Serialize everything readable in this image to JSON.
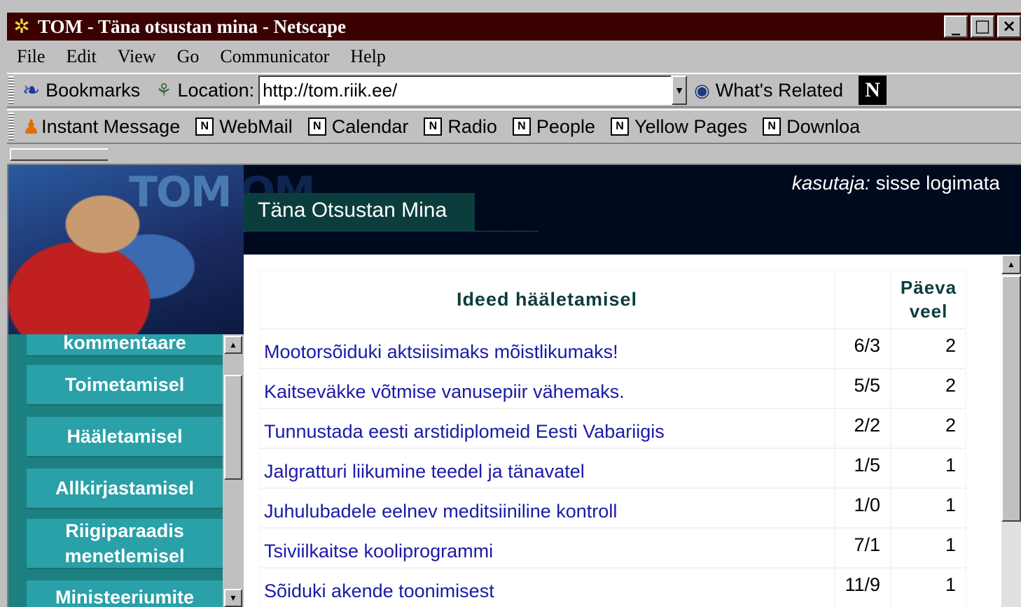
{
  "window": {
    "title": "TOM - Täna otsustan mina - Netscape"
  },
  "menu": [
    "File",
    "Edit",
    "View",
    "Go",
    "Communicator",
    "Help"
  ],
  "nav_toolbar": {
    "bookmarks": "Bookmarks",
    "location_label": "Location:",
    "location_value": "http://tom.riik.ee/",
    "whats_related": "What's Related"
  },
  "personal_toolbar": {
    "items": [
      "Instant Message",
      "WebMail",
      "Calendar",
      "Radio",
      "People",
      "Yellow Pages",
      "Downloa"
    ]
  },
  "header": {
    "logo": "TOM",
    "site_title": "Täna Otsustan Mina",
    "user_label": "kasutaja:",
    "user_status": "sisse logimata"
  },
  "sidebar": {
    "items": [
      "kommentaare",
      "Toimetamisel",
      "Hääletamisel",
      "Allkirjastamisel",
      "Riigiparaadis menetlemisel",
      "Ministeeriumite"
    ]
  },
  "table": {
    "header_title": "Ideed hääletamisel",
    "header_days_line1": "Päeva",
    "header_days_line2": "veel",
    "rows": [
      {
        "title": "Mootorsõiduki aktsiisimaks mõistlikumaks!",
        "votes": "6/3",
        "days": "2"
      },
      {
        "title": "Kaitseväkke võtmise vanusepiir vähemaks.",
        "votes": "5/5",
        "days": "2"
      },
      {
        "title": "Tunnustada eesti arstidiplomeid Eesti Vabariigis",
        "votes": "2/2",
        "days": "2"
      },
      {
        "title": "Jalgratturi liikumine teedel ja tänavatel",
        "votes": "1/5",
        "days": "1"
      },
      {
        "title": "Juhulubadele eelnev meditsiiniline kontroll",
        "votes": "1/0",
        "days": "1"
      },
      {
        "title": "Tsiviilkaitse kooliprogrammi",
        "votes": "7/1",
        "days": "1"
      },
      {
        "title": "Sõiduki akende toonimisest",
        "votes": "11/9",
        "days": "1"
      }
    ]
  }
}
